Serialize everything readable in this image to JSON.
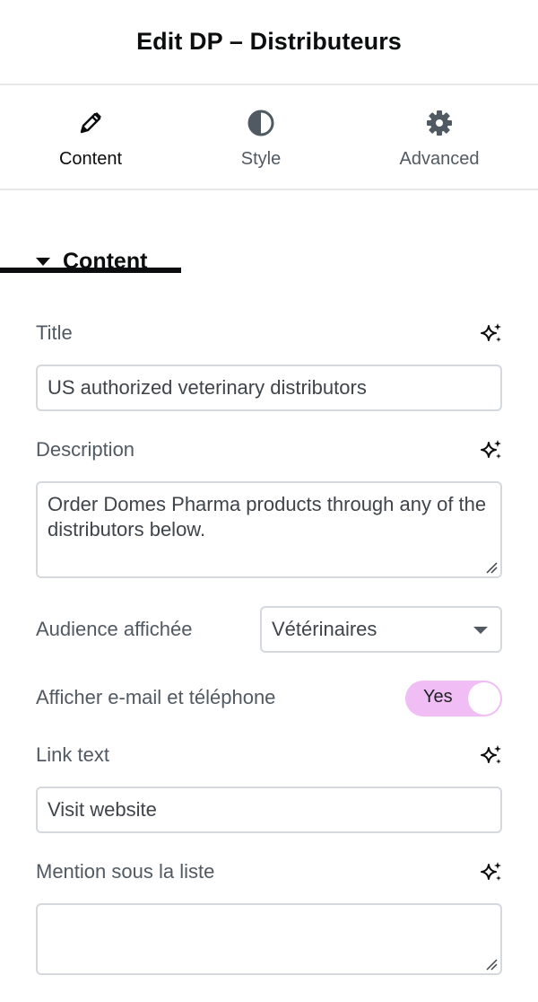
{
  "header": {
    "title": "Edit DP – Distributeurs"
  },
  "tabs": [
    {
      "label": "Content",
      "icon": "pencil-icon",
      "active": true
    },
    {
      "label": "Style",
      "icon": "contrast-icon",
      "active": false
    },
    {
      "label": "Advanced",
      "icon": "gear-icon",
      "active": false
    }
  ],
  "section": {
    "title": "Content",
    "icon": "caret-down-icon"
  },
  "fields": {
    "title": {
      "label": "Title",
      "value": "US authorized veterinary distributors"
    },
    "description": {
      "label": "Description",
      "value": "Order Domes Pharma products through any of the distributors below."
    },
    "audience": {
      "label": "Audience affichée",
      "value": "Vétérinaires"
    },
    "show_contact": {
      "label": "Afficher e-mail et téléphone",
      "toggle_label": "Yes",
      "on": true
    },
    "link_text": {
      "label": "Link text",
      "value": "Visit website"
    },
    "mention": {
      "label": "Mention sous la liste",
      "value": ""
    }
  },
  "colors": {
    "toggle_on": "#f0bdf4",
    "active_tab_underline": "#0c0d0e",
    "border": "#d5d8dc"
  }
}
